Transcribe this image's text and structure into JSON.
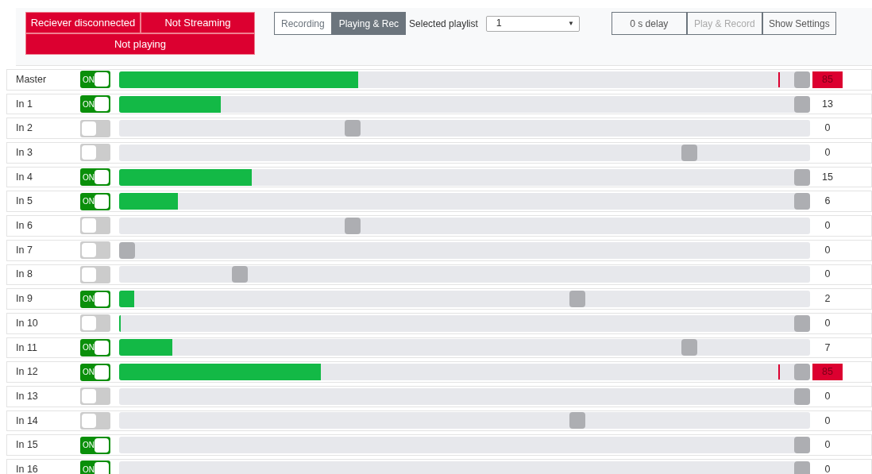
{
  "status": {
    "items": [
      {
        "label": "Reciever disconnected",
        "alert": true
      },
      {
        "label": "Not Streaming",
        "alert": true
      },
      {
        "label": "Not playing",
        "alert": true
      }
    ]
  },
  "modes": [
    {
      "label": "Recording",
      "selected": false
    },
    {
      "label": "Playing & Rec",
      "selected": true
    }
  ],
  "playlist": {
    "label": "Selected playlist",
    "value": "1",
    "caret": "▼"
  },
  "actions": [
    {
      "label": "0 s delay",
      "disabled": false
    },
    {
      "label": "Play & Record",
      "disabled": true
    },
    {
      "label": "Show Settings",
      "disabled": false
    }
  ],
  "channels": [
    {
      "name": "Master",
      "on": true,
      "on_label": "ON",
      "meter": {
        "level": 0.346
      },
      "fader": {
        "level": 1.0
      },
      "clipping": true,
      "value": "85"
    },
    {
      "name": "In 1",
      "on": true,
      "on_label": "ON",
      "meter": {
        "level": 0.147
      },
      "fader": {
        "level": 1.0
      },
      "clipping": false,
      "value": "13"
    },
    {
      "name": "In 2",
      "on": false,
      "fader": {
        "level": 0.334
      },
      "clipping": false,
      "value": "0"
    },
    {
      "name": "In 3",
      "on": false,
      "fader": {
        "level": 0.833
      },
      "clipping": false,
      "value": "0"
    },
    {
      "name": "In 4",
      "on": true,
      "on_label": "ON",
      "meter": {
        "level": 0.192
      },
      "fader": {
        "level": 1.0
      },
      "clipping": false,
      "value": "15"
    },
    {
      "name": "In 5",
      "on": true,
      "on_label": "ON",
      "meter": {
        "level": 0.085
      },
      "fader": {
        "level": 1.0
      },
      "clipping": false,
      "value": "6"
    },
    {
      "name": "In 6",
      "on": false,
      "fader": {
        "level": 0.334
      },
      "clipping": false,
      "value": "0"
    },
    {
      "name": "In 7",
      "on": false,
      "fader": {
        "level": 0
      },
      "clipping": false,
      "value": "0"
    },
    {
      "name": "In 8",
      "on": false,
      "fader": {
        "level": 0.167
      },
      "clipping": false,
      "value": "0"
    },
    {
      "name": "In 9",
      "on": true,
      "on_label": "ON",
      "meter": {
        "level": 0.022
      },
      "fader": {
        "level": 0.667
      },
      "clipping": false,
      "value": "2"
    },
    {
      "name": "In 10",
      "on": false,
      "meter": {
        "level": 0.002
      },
      "fader": {
        "level": 1.0
      },
      "clipping": false,
      "value": "0"
    },
    {
      "name": "In 11",
      "on": true,
      "on_label": "ON",
      "meter": {
        "level": 0.077
      },
      "fader": {
        "level": 0.833
      },
      "clipping": false,
      "value": "7"
    },
    {
      "name": "In 12",
      "on": true,
      "on_label": "ON",
      "meter": {
        "level": 0.292
      },
      "fader": {
        "level": 1.0
      },
      "clipping": true,
      "value": "85"
    },
    {
      "name": "In 13",
      "on": false,
      "fader": {
        "level": 1.0
      },
      "clipping": false,
      "value": "0"
    },
    {
      "name": "In 14",
      "on": false,
      "fader": {
        "level": 0.667
      },
      "clipping": false,
      "value": "0"
    },
    {
      "name": "In 15",
      "on": true,
      "on_label": "ON",
      "fader": {
        "level": 1.0
      },
      "clipping": false,
      "value": "0"
    },
    {
      "name": "In 16",
      "on": true,
      "on_label": "ON",
      "fader": {
        "level": 1.0
      },
      "clipping": false,
      "value": "0"
    }
  ]
}
